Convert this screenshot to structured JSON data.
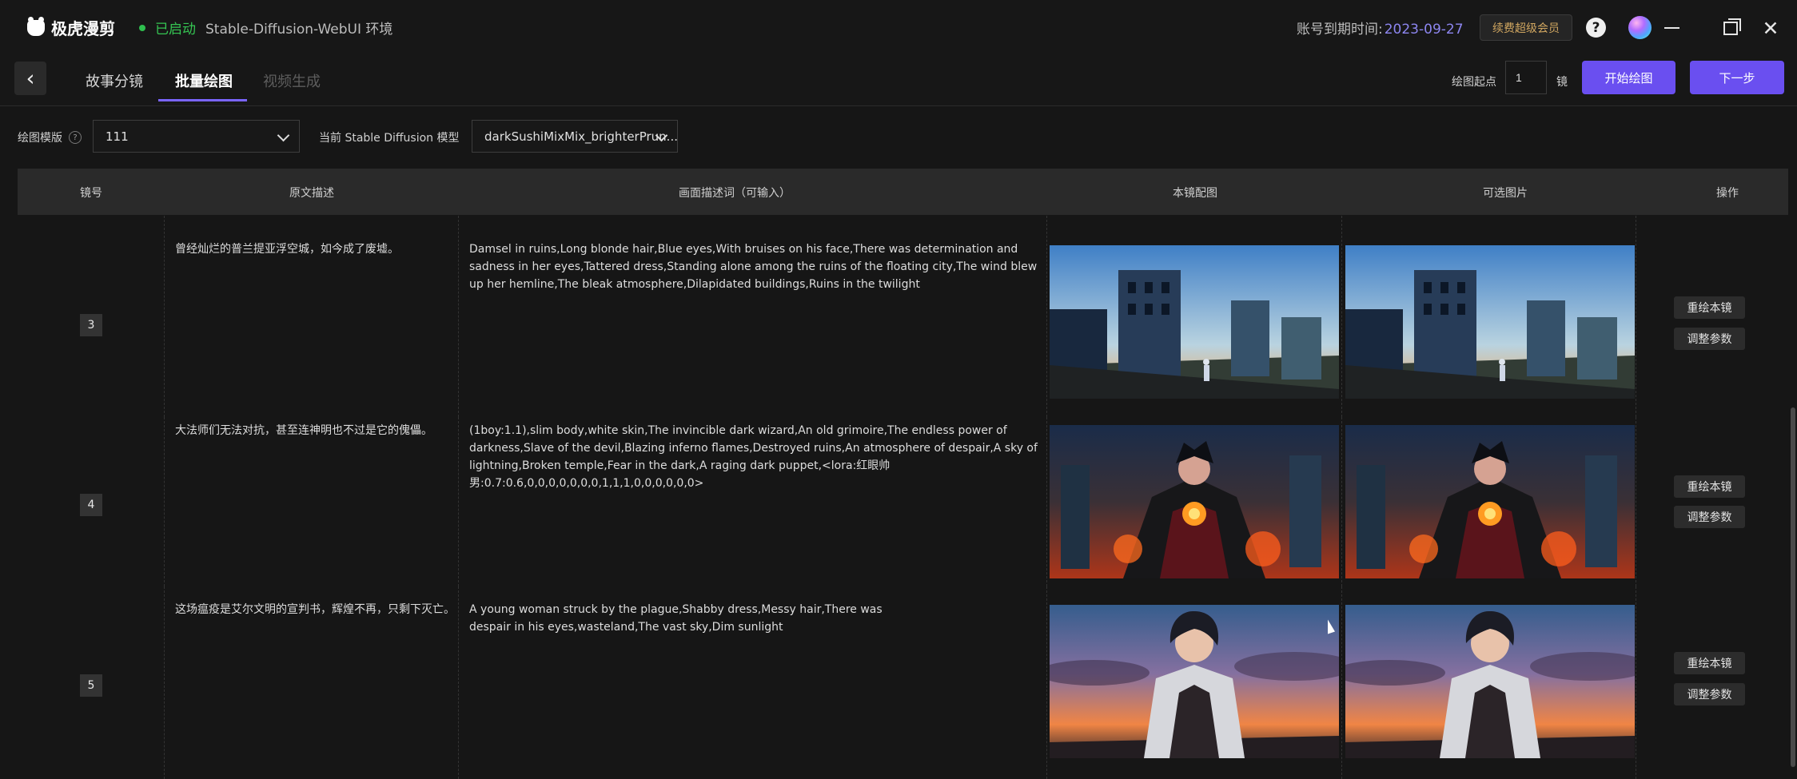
{
  "app": {
    "logo_text": "极虎漫剪",
    "status": "已启动",
    "environment": "Stable-Diffusion-WebUI 环境",
    "expiry_label": "账号到期时间:",
    "expiry_date": "2023-09-27",
    "renew_button": "续费超级会员",
    "help_icon_label": "?",
    "close_icon_label": "✕",
    "back_icon_label": "‹"
  },
  "nav": {
    "tabs": [
      {
        "label": "故事分镜",
        "state": "inactive"
      },
      {
        "label": "批量绘图",
        "state": "active"
      },
      {
        "label": "视频生成",
        "state": "disabled"
      }
    ],
    "start_label": "绘图起点",
    "start_value": "1",
    "start_unit": "镜",
    "start_drawing_button": "开始绘图",
    "next_button": "下一步"
  },
  "controls": {
    "template_label": "绘图模版",
    "template_info_icon": "?",
    "template_value": "111",
    "model_label": "当前 Stable Diffusion 模型",
    "model_value": "darkSushiMixMix_brighterPrun..."
  },
  "table": {
    "headers": [
      "镜号",
      "原文描述",
      "画面描述词（可输入）",
      "本镜配图",
      "可选图片",
      "操作"
    ],
    "rows": [
      {
        "shot": "3",
        "original": "曾经灿烂的普兰提亚浮空城，如今成了废墟。",
        "prompt": "Damsel in ruins,Long blonde hair,Blue eyes,With bruises on his face,There was determination and sadness in her eyes,Tattered dress,Standing alone among the ruins of the floating city,The wind blew up her hemline,The bleak atmosphere,Dilapidated buildings,Ruins in the twilight",
        "image": "ruins-scene",
        "actions": [
          "重绘本镜",
          "调整参数"
        ]
      },
      {
        "shot": "4",
        "original": "大法师们无法对抗，甚至连神明也不过是它的傀儡。",
        "prompt": "(1boy:1.1),slim body,white skin,The invincible dark wizard,An old grimoire,The endless power of darkness,Slave of the devil,Blazing inferno flames,Destroyed ruins,An atmosphere of despair,A sky of lightning,Broken temple,Fear in the dark,A raging dark puppet,<lora:红眼帅男:0.7:0.6,0,0,0,0,0,0,0,1,1,1,0,0,0,0,0,0>",
        "image": "dark-wizard-scene",
        "actions": [
          "重绘本镜",
          "调整参数"
        ]
      },
      {
        "shot": "5",
        "original": "这场瘟疫是艾尔文明的宣判书，辉煌不再，只剩下灭亡。",
        "prompt": "A young woman struck by the plague,Shabby dress,Messy hair,There was despair in his eyes,wasteland,The vast sky,Dim sunlight",
        "image": "plague-woman-scene",
        "actions": [
          "重绘本镜",
          "调整参数"
        ]
      }
    ]
  },
  "colors": {
    "accent": "#6a4ff0",
    "status_green": "#35c552",
    "expiry_purple": "#8d86f0",
    "renew_gold": "#d0a660"
  }
}
